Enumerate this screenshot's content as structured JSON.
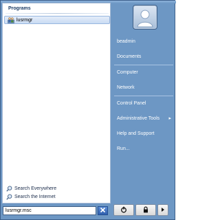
{
  "left_panel": {
    "programs_header": "Programs",
    "programs": [
      {
        "label": "lusrmgr",
        "icon": "users-groups-icon"
      }
    ],
    "search_links": [
      {
        "label": "Search Everywhere",
        "icon": "search-icon"
      },
      {
        "label": "Search the Internet",
        "icon": "search-icon"
      }
    ]
  },
  "search_box": {
    "value": "lusrmgr.msc"
  },
  "right_panel": {
    "user_picture_icon": "user-avatar-icon",
    "items": [
      {
        "label": "beadmin"
      },
      {
        "label": "Documents"
      },
      {
        "label": "Computer"
      },
      {
        "label": "Network"
      },
      {
        "label": "Control Panel"
      },
      {
        "label": "Administrative Tools",
        "has_submenu": true
      },
      {
        "label": "Help and Support"
      },
      {
        "label": "Run..."
      }
    ]
  },
  "bottom_bar": {
    "clear_icon": "close-icon",
    "power_icon": "power-icon",
    "lock_icon": "lock-icon",
    "options_icon": "chevron-right-icon"
  },
  "colors": {
    "menu_blue": "#6d97c4",
    "highlight": "#c9dbf3",
    "clear_button": "#3a6bbd"
  }
}
